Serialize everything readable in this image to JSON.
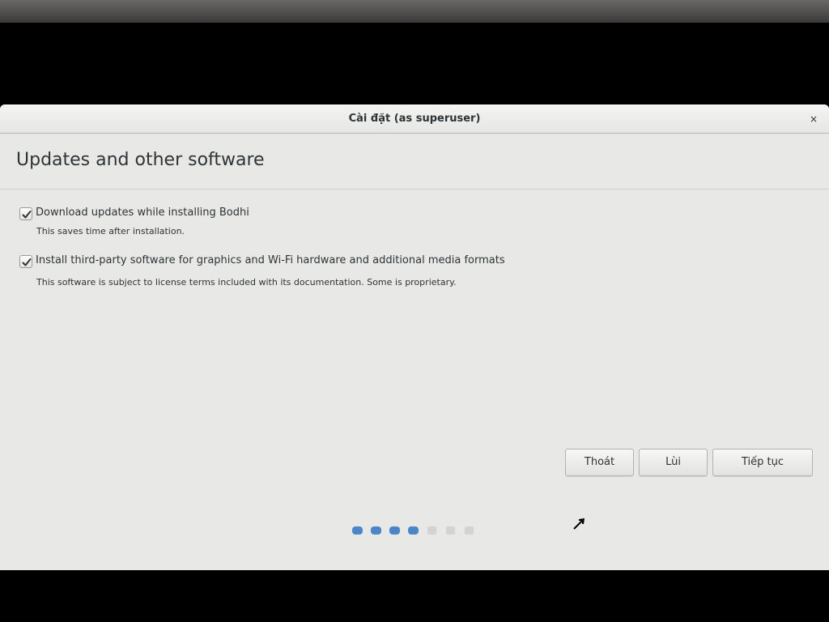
{
  "window": {
    "title": "Cài đặt (as superuser)",
    "close_label": "×"
  },
  "page": {
    "title": "Updates and other software"
  },
  "options": [
    {
      "label": "Download updates while installing Bodhi",
      "description": "This saves time after installation.",
      "checked": true
    },
    {
      "label": "Install third-party software for graphics and Wi-Fi hardware and additional media formats",
      "description": "This software is subject to license terms included with its documentation. Some is proprietary.",
      "checked": true
    }
  ],
  "buttons": {
    "quit": "Thoát",
    "back": "Lùi",
    "continue": "Tiếp tục"
  },
  "progress": {
    "total_steps": 7,
    "completed_steps": 4,
    "active_color": "#4a86c8",
    "inactive_color": "#d3d3d2"
  }
}
